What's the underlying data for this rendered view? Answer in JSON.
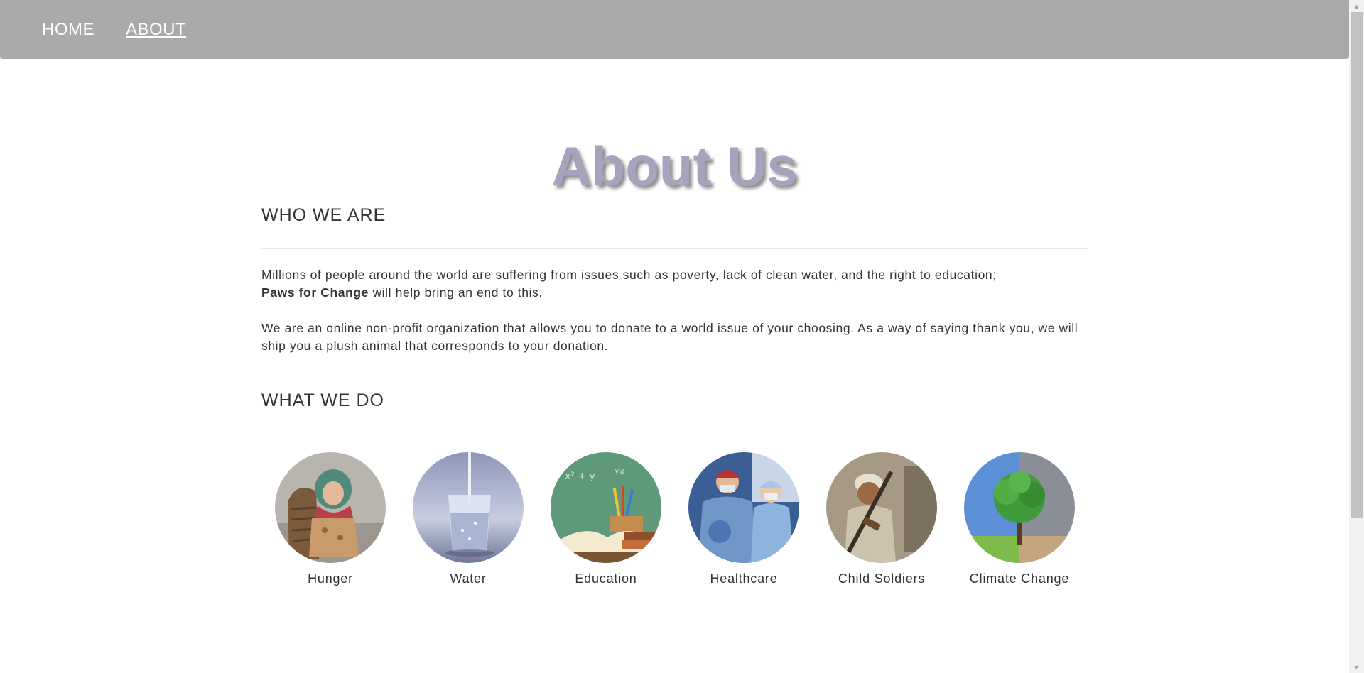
{
  "nav": {
    "home": "HOME",
    "about": "ABOUT"
  },
  "page_title": "About Us",
  "who_we_are": {
    "heading": "WHO WE ARE",
    "p1_text": "Millions of people around the world are suffering from issues such as poverty, lack of clean water, and the right to education;",
    "p1_brand": "Paws for Change",
    "p1_tail": " will help bring an end to this.",
    "p2": "We are an online non-profit organization that allows you to donate to a world issue of your choosing. As a way of saying thank you, we will ship you a plush animal that corresponds to your donation."
  },
  "what_we_do": {
    "heading": "WHAT WE DO",
    "causes": [
      {
        "label": "Hunger",
        "icon": "hunger-photo"
      },
      {
        "label": "Water",
        "icon": "water-glass-photo"
      },
      {
        "label": "Education",
        "icon": "books-pencils-photo"
      },
      {
        "label": "Healthcare",
        "icon": "surgeons-photo"
      },
      {
        "label": "Child Soldiers",
        "icon": "child-soldier-photo"
      },
      {
        "label": "Climate Change",
        "icon": "tree-photo"
      }
    ]
  },
  "colors": {
    "navbar": "#aaaaaa",
    "title": "#a7a3bd",
    "text": "#333333"
  }
}
